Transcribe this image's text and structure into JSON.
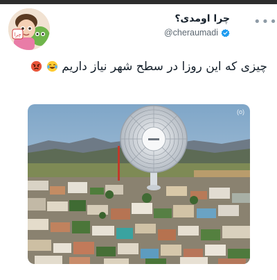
{
  "tweet": {
    "display_name": "چرا اومدی؟",
    "handle": "@cheraumadi",
    "text": "چیزی که این روزا در سطح شهر نیاز داریم",
    "emojis": [
      "laughing-emoji",
      "angry-emoji"
    ],
    "more_icon": "more-options-icon",
    "verified_icon": "verified-badge-icon",
    "accent_color": "#1d9bf0"
  },
  "media": {
    "watermark": "(o)",
    "subject": [
      "giant-fan",
      "town-cityscape"
    ]
  }
}
